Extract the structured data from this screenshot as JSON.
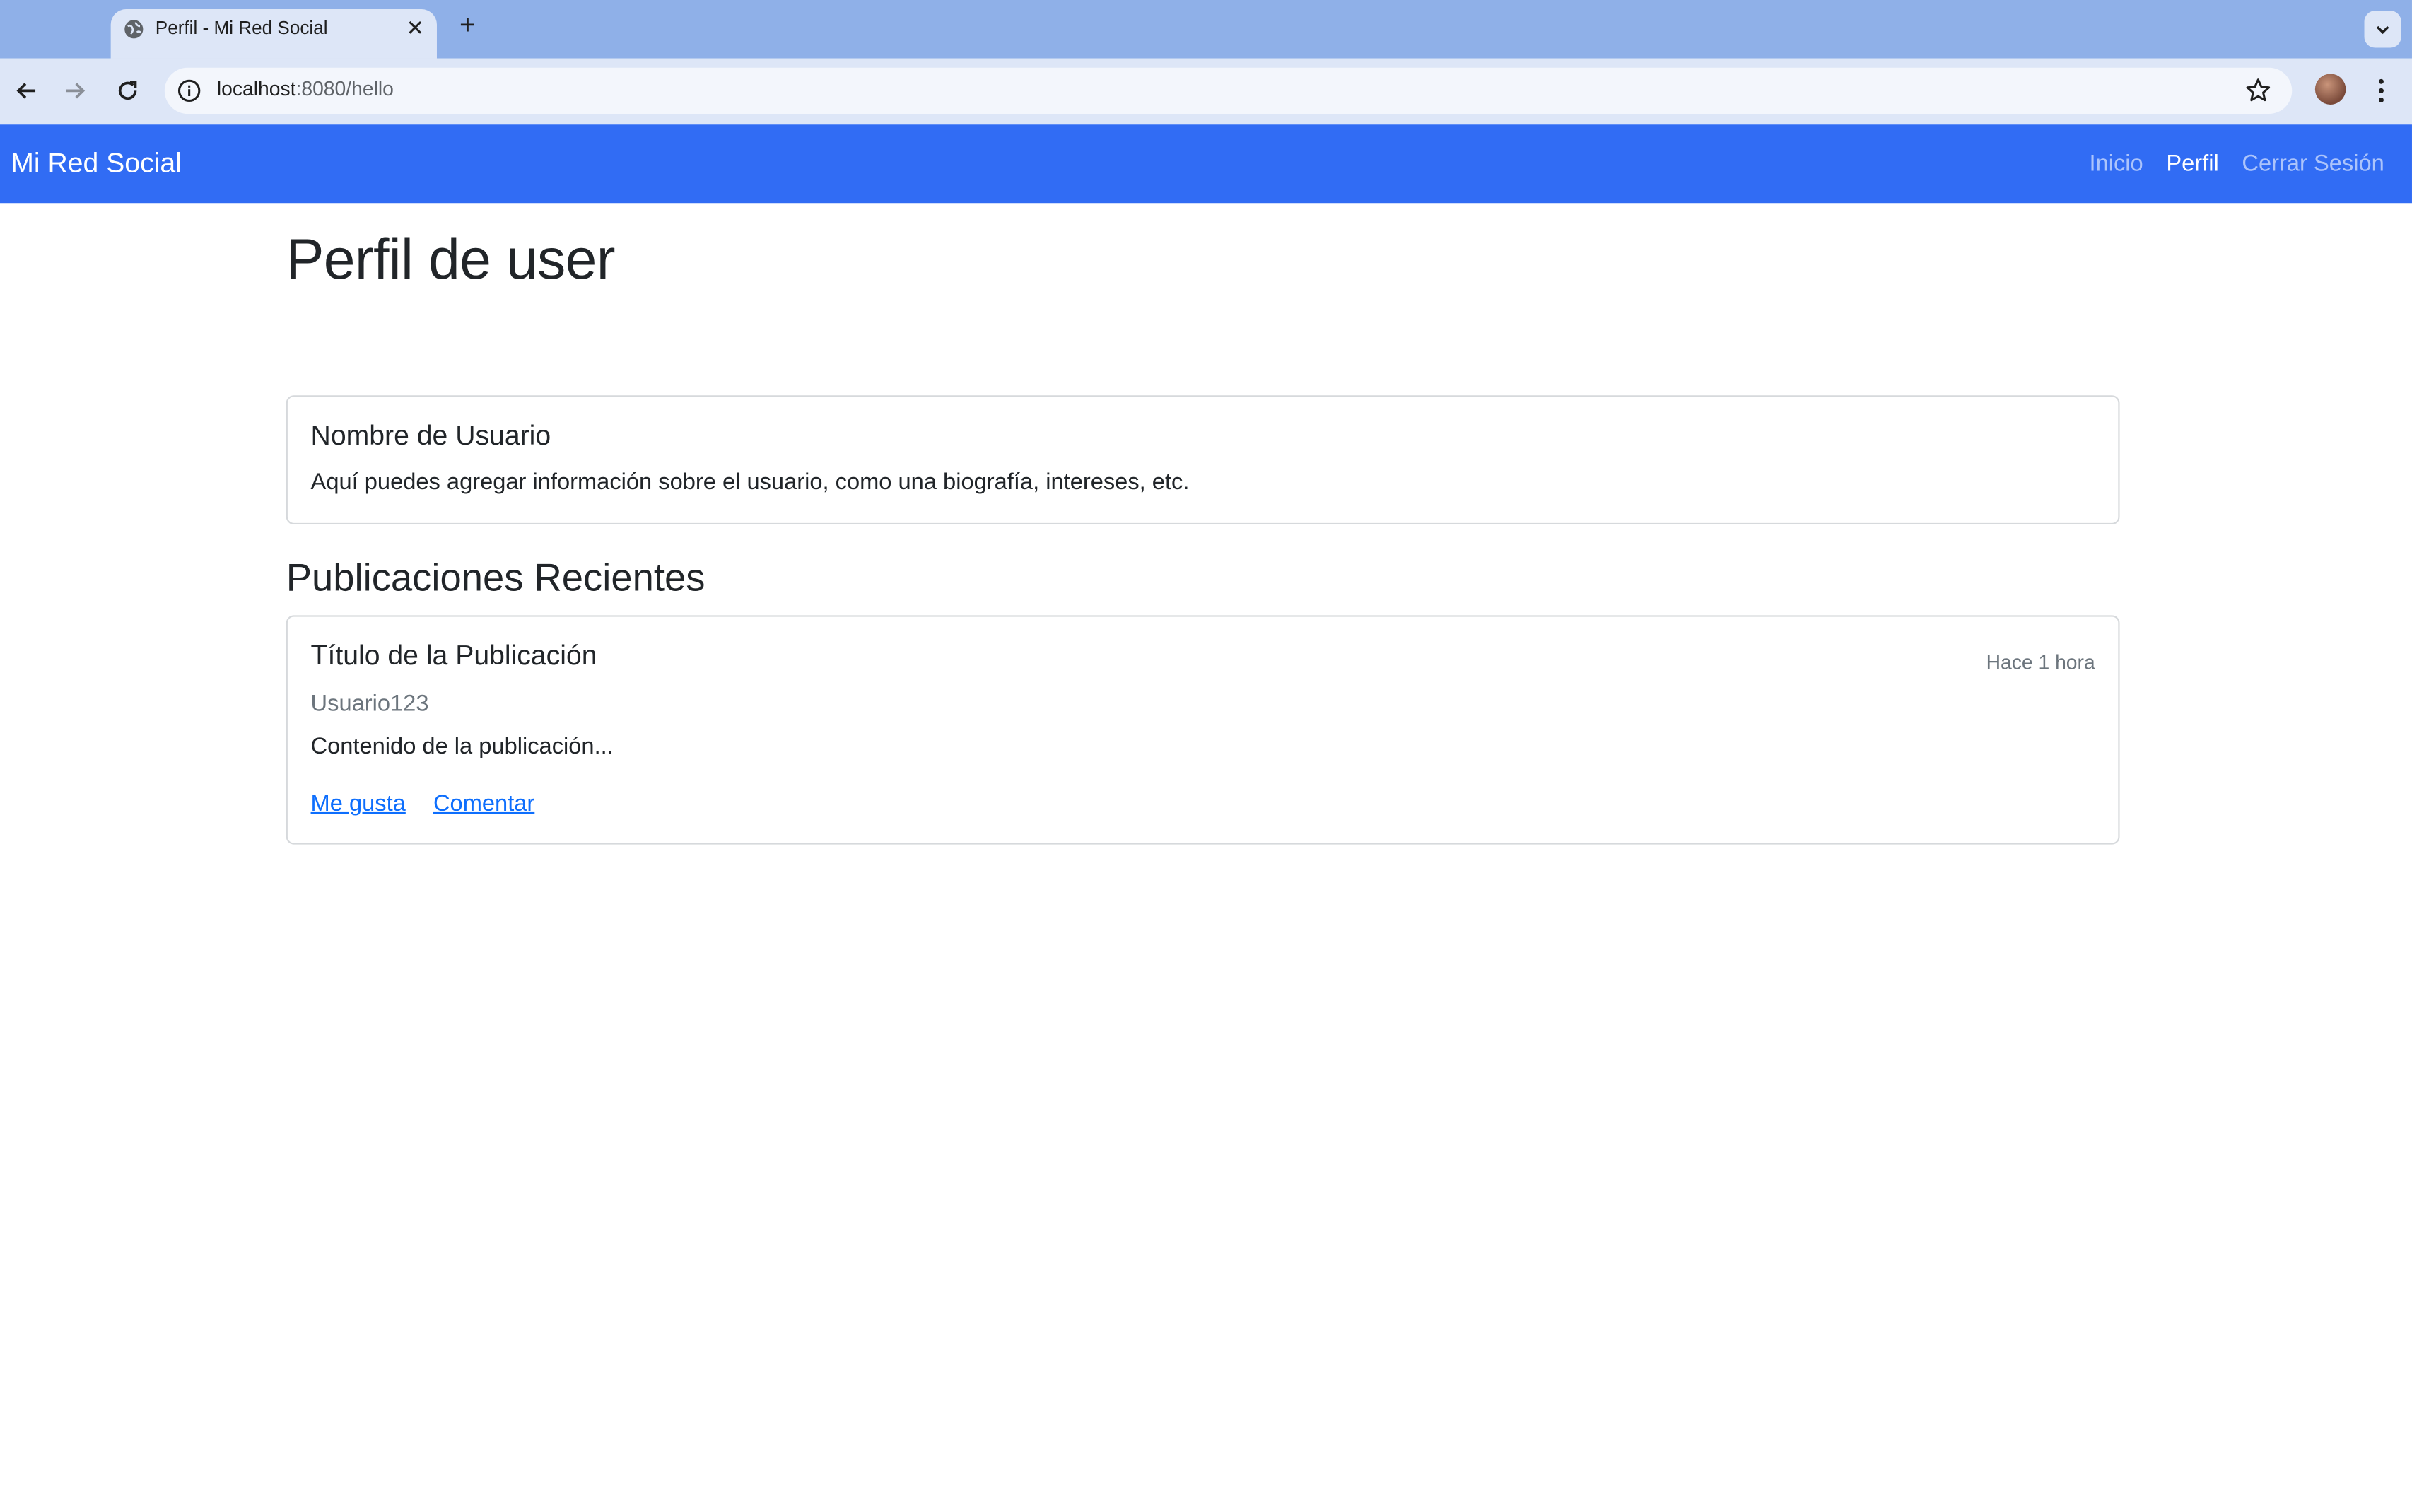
{
  "browser": {
    "tab_title": "Perfil - Mi Red Social",
    "url_host": "localhost",
    "url_path": ":8080/hello"
  },
  "navbar": {
    "brand": "Mi Red Social",
    "links": [
      {
        "label": "Inicio",
        "active": false
      },
      {
        "label": "Perfil",
        "active": true
      },
      {
        "label": "Cerrar Sesión",
        "active": false
      }
    ]
  },
  "page": {
    "title": "Perfil de user"
  },
  "profile_card": {
    "title": "Nombre de Usuario",
    "text": "Aquí puedes agregar información sobre el usuario, como una biografía, intereses, etc."
  },
  "posts_section": {
    "title": "Publicaciones Recientes",
    "post": {
      "title": "Título de la Publicación",
      "time": "Hace 1 hora",
      "author": "Usuario123",
      "content": "Contenido de la publicación...",
      "actions": [
        "Me gusta",
        "Comentar"
      ]
    }
  },
  "colors": {
    "navbar_bg": "#316cf4",
    "tabstrip_bg": "#8fb0e8",
    "link": "#0d6efd"
  },
  "icons": {
    "tab_favicon": "globe-icon",
    "tab_close": "close-icon",
    "new_tab": "plus-icon",
    "back": "back-arrow-icon",
    "forward": "forward-arrow-icon",
    "reload": "reload-icon",
    "site_info": "info-icon",
    "bookmark": "star-icon",
    "menu": "kebab-menu-icon"
  }
}
